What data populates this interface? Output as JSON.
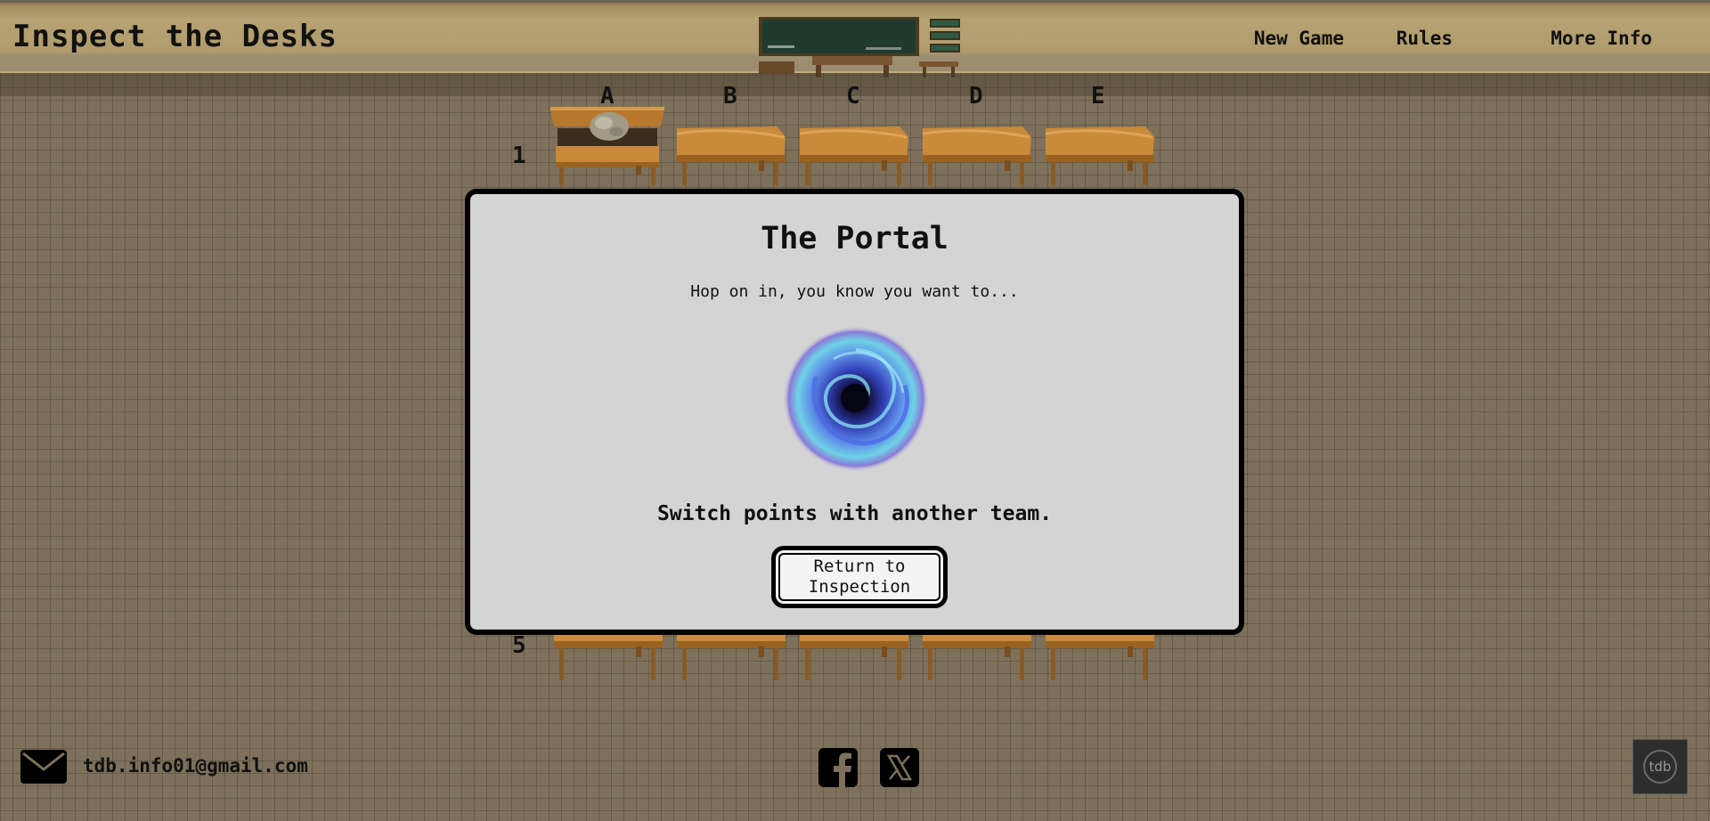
{
  "header": {
    "title": "Inspect the Desks",
    "nav": [
      {
        "label": "New Game"
      },
      {
        "label": "Rules"
      },
      {
        "label": "More Info"
      }
    ]
  },
  "board": {
    "columns": [
      "A",
      "B",
      "C",
      "D",
      "E"
    ],
    "rows_visible": [
      "1",
      "5"
    ]
  },
  "modal": {
    "title": "The Portal",
    "subtitle": "Hop on in, you know you want to...",
    "effect": "Switch points with another team.",
    "button_label": "Return to Inspection"
  },
  "footer": {
    "email": "tdb.info01@gmail.com",
    "badge": "tdb"
  },
  "colors": {
    "background": "#7e715c",
    "desk_top": "#c98a3a",
    "modal_bg": "#d4d4d4",
    "portal": "#4d5be0"
  },
  "icons": [
    "classroom-icon",
    "mail-icon",
    "facebook-icon",
    "x-icon",
    "tdb-badge-icon",
    "portal-image"
  ]
}
